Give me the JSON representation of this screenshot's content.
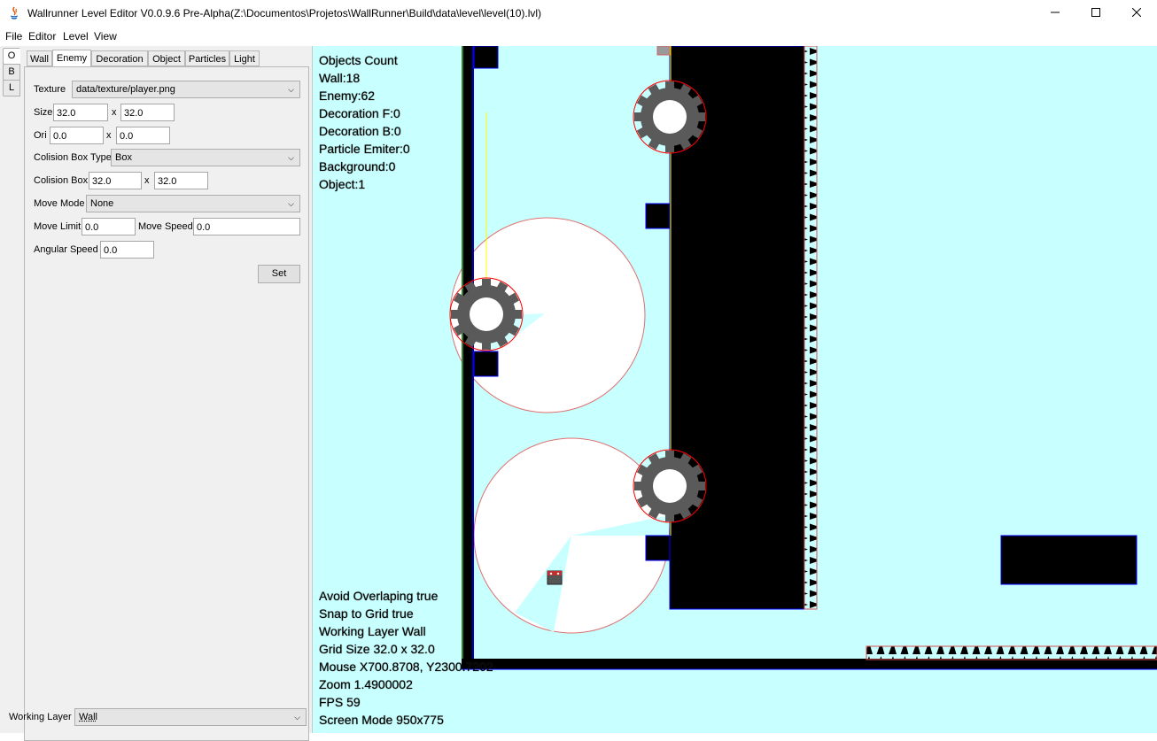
{
  "window": {
    "title": "Wallrunner Level Editor V0.0.9.6 Pre-Alpha(Z:\\Documentos\\Projetos\\WallRunner\\Build\\data\\level\\level(10).lvl)",
    "controls": [
      "minimize-icon",
      "maximize-icon",
      "close-icon"
    ]
  },
  "menu": {
    "file": "File",
    "editor": "Editor",
    "level": "Level",
    "view": "View"
  },
  "side_tabs": [
    "O",
    "B",
    "L"
  ],
  "tabs": [
    "Wall",
    "Enemy",
    "Decoration",
    "Object",
    "Particles",
    "Light"
  ],
  "active_tab": "Enemy",
  "form": {
    "texture_label": "Texture",
    "texture_value": "data/texture/player.png",
    "size_label": "Size",
    "size_w": "32.0",
    "size_h": "32.0",
    "x_sep": "x",
    "ori_label": "Ori",
    "ori_x": "0.0",
    "ori_y": "0.0",
    "colbox_type_label": "Colision Box Type",
    "colbox_type_value": "Box",
    "colbox_label": "Colision Box",
    "colbox_w": "32.0",
    "colbox_h": "32.0",
    "move_mode_label": "Move Mode",
    "move_mode_value": "None",
    "move_limit_label": "Move Limit",
    "move_limit_value": "0.0",
    "move_speed_label": "Move Speed",
    "move_speed_value": "0.0",
    "angular_speed_label": "Angular Speed",
    "angular_speed_value": "0.0",
    "set_button": "Set"
  },
  "working_layer": {
    "label": "Working Layer",
    "value": "Wall"
  },
  "overlay_top": {
    "header": "Objects Count",
    "wall": "Wall:18",
    "enemy": "Enemy:62",
    "decoration_f": "Decoration F:0",
    "decoration_b": "Decoration B:0",
    "particle_emiter": "Particle Emiter:0",
    "background": "Background:0",
    "object": "Object:1"
  },
  "overlay_bottom": {
    "avoid_overlaping": "Avoid Overlaping true",
    "snap_to_grid": "Snap to Grid true",
    "working_layer": "Working Layer Wall",
    "grid_size": "Grid Size 32.0 x 32.0",
    "mouse": "Mouse X700.8708, Y2300.7202",
    "zoom": "Zoom 1.4900002",
    "fps": "FPS 59",
    "screen_mode": "Screen Mode 950x775"
  },
  "colors": {
    "canvas_bg": "#c8ffff",
    "wall": "#000000",
    "wall_outline": "#0000ff",
    "enemy_radius": "#ff0000",
    "gear": "#606060",
    "path_line": "#ffff00"
  }
}
